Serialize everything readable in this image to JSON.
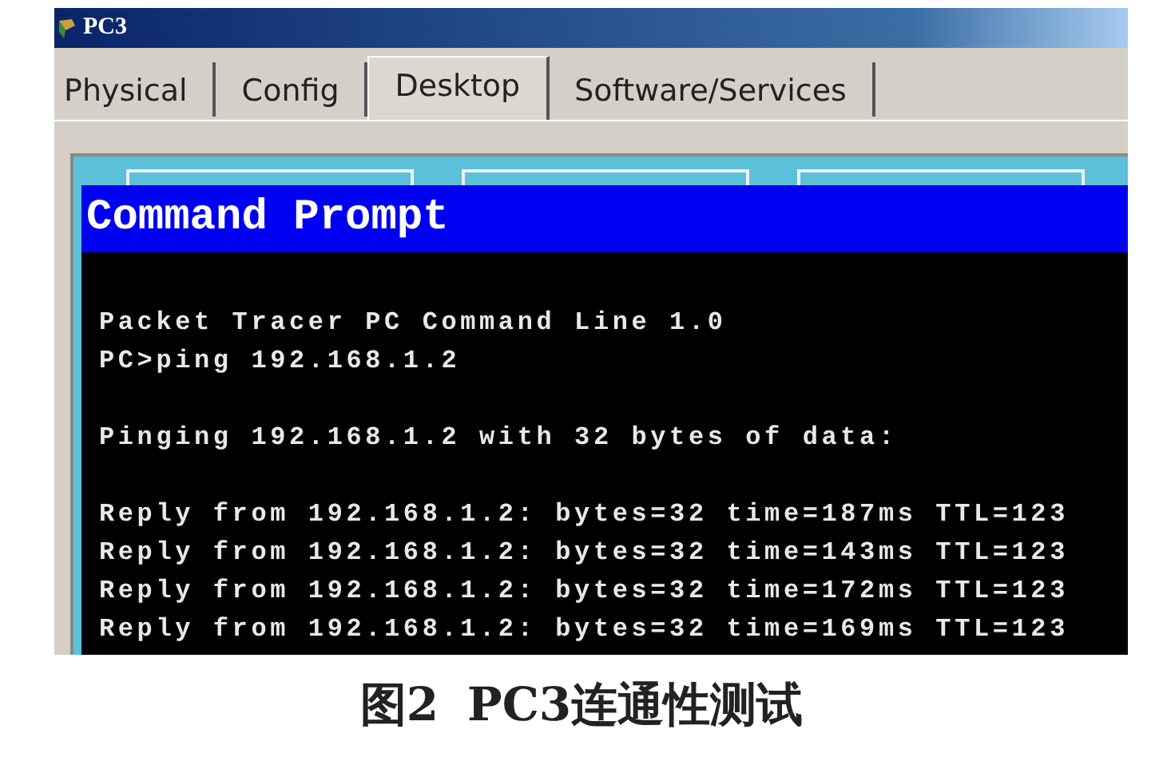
{
  "window": {
    "title": "PC3"
  },
  "tabs": [
    {
      "label": "Physical",
      "selected": false
    },
    {
      "label": "Config",
      "selected": false
    },
    {
      "label": "Desktop",
      "selected": true
    },
    {
      "label": "Software/Services",
      "selected": false
    }
  ],
  "command_prompt": {
    "title": "Command Prompt",
    "blocks": [
      [
        "Packet Tracer PC Command Line 1.0",
        "PC>ping 192.168.1.2"
      ],
      [
        "Pinging 192.168.1.2 with 32 bytes of data:"
      ],
      [
        "Reply from 192.168.1.2: bytes=32 time=187ms TTL=123",
        "Reply from 192.168.1.2: bytes=32 time=143ms TTL=123",
        "Reply from 192.168.1.2: bytes=32 time=172ms TTL=123",
        "Reply from 192.168.1.2: bytes=32 time=169ms TTL=123"
      ]
    ]
  },
  "caption": {
    "number": "图2",
    "text": "PC3连通性测试"
  }
}
